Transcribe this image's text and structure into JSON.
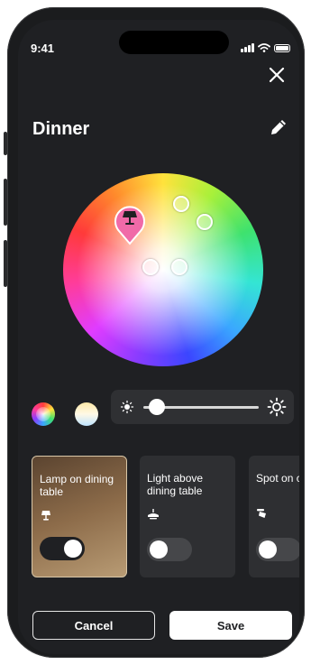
{
  "status": {
    "time": "9:41"
  },
  "scene": {
    "title": "Dinner"
  },
  "brightness": {
    "level": 0.12
  },
  "lights": [
    {
      "label": "Lamp on dining table",
      "icon": "table-lamp-icon",
      "on": true
    },
    {
      "label": "Light above dining table",
      "icon": "pendant-light-icon",
      "on": false
    },
    {
      "label": "Spot on cabinet",
      "icon": "spot-light-icon",
      "on": false
    }
  ],
  "actions": {
    "cancel": "Cancel",
    "save": "Save"
  }
}
